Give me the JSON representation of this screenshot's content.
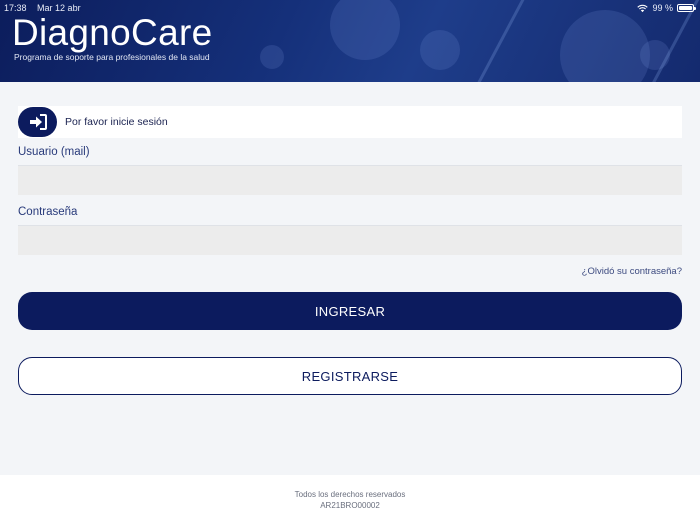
{
  "status_bar": {
    "time": "17:38",
    "date": "Mar 12 abr",
    "battery": "99 %"
  },
  "header": {
    "brand": "DiagnoCare",
    "tagline": "Programa de soporte para profesionales de la salud"
  },
  "login": {
    "banner_text": "Por favor inicie sesión",
    "username_label": "Usuario (mail)",
    "username_value": "",
    "password_label": "Contraseña",
    "password_value": "",
    "forgot_link": "¿Olvidó su contraseña?",
    "submit_label": "INGRESAR",
    "register_label": "REGISTRARSE"
  },
  "footer": {
    "rights": "Todos los derechos reservados",
    "code": "AR21BRO00002"
  },
  "colors": {
    "primary": "#0c1b5e",
    "header": "#15307a",
    "background": "#f3f5f8"
  },
  "icons": {
    "login": "sign-in-icon",
    "wifi": "wifi-icon",
    "battery": "battery-icon"
  }
}
